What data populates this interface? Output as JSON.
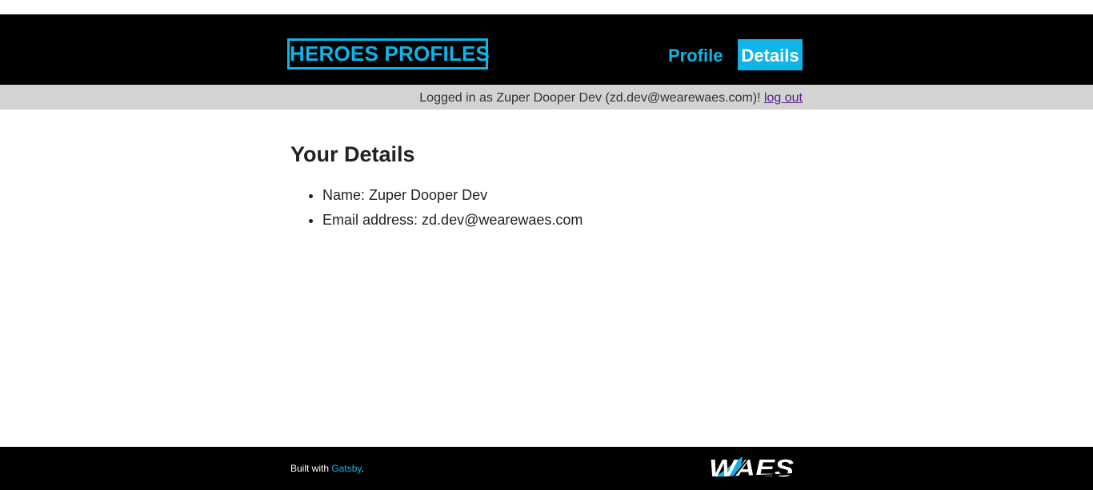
{
  "header": {
    "logo_text": "HEROES PROFILES",
    "nav": [
      {
        "label": "Profile",
        "active": false
      },
      {
        "label": "Details",
        "active": true
      }
    ]
  },
  "status": {
    "text": "Logged in as Zuper Dooper Dev (zd.dev@wearewaes.com)! ",
    "logout_label": "log out"
  },
  "main": {
    "title": "Your Details",
    "items": [
      "Name: Zuper Dooper Dev",
      "Email address: zd.dev@wearewaes.com"
    ]
  },
  "footer": {
    "built_with_prefix": "Built with ",
    "gatsby_link": "Gatsby",
    "built_with_suffix": ".",
    "brand_logo_text": "WAES"
  },
  "colors": {
    "accent": "#0fb4e8",
    "header_bg": "#000000",
    "status_bg": "#d3d3d3",
    "link_visited": "#551a8b"
  },
  "icons": {
    "brand_logo": "waes-logo"
  }
}
